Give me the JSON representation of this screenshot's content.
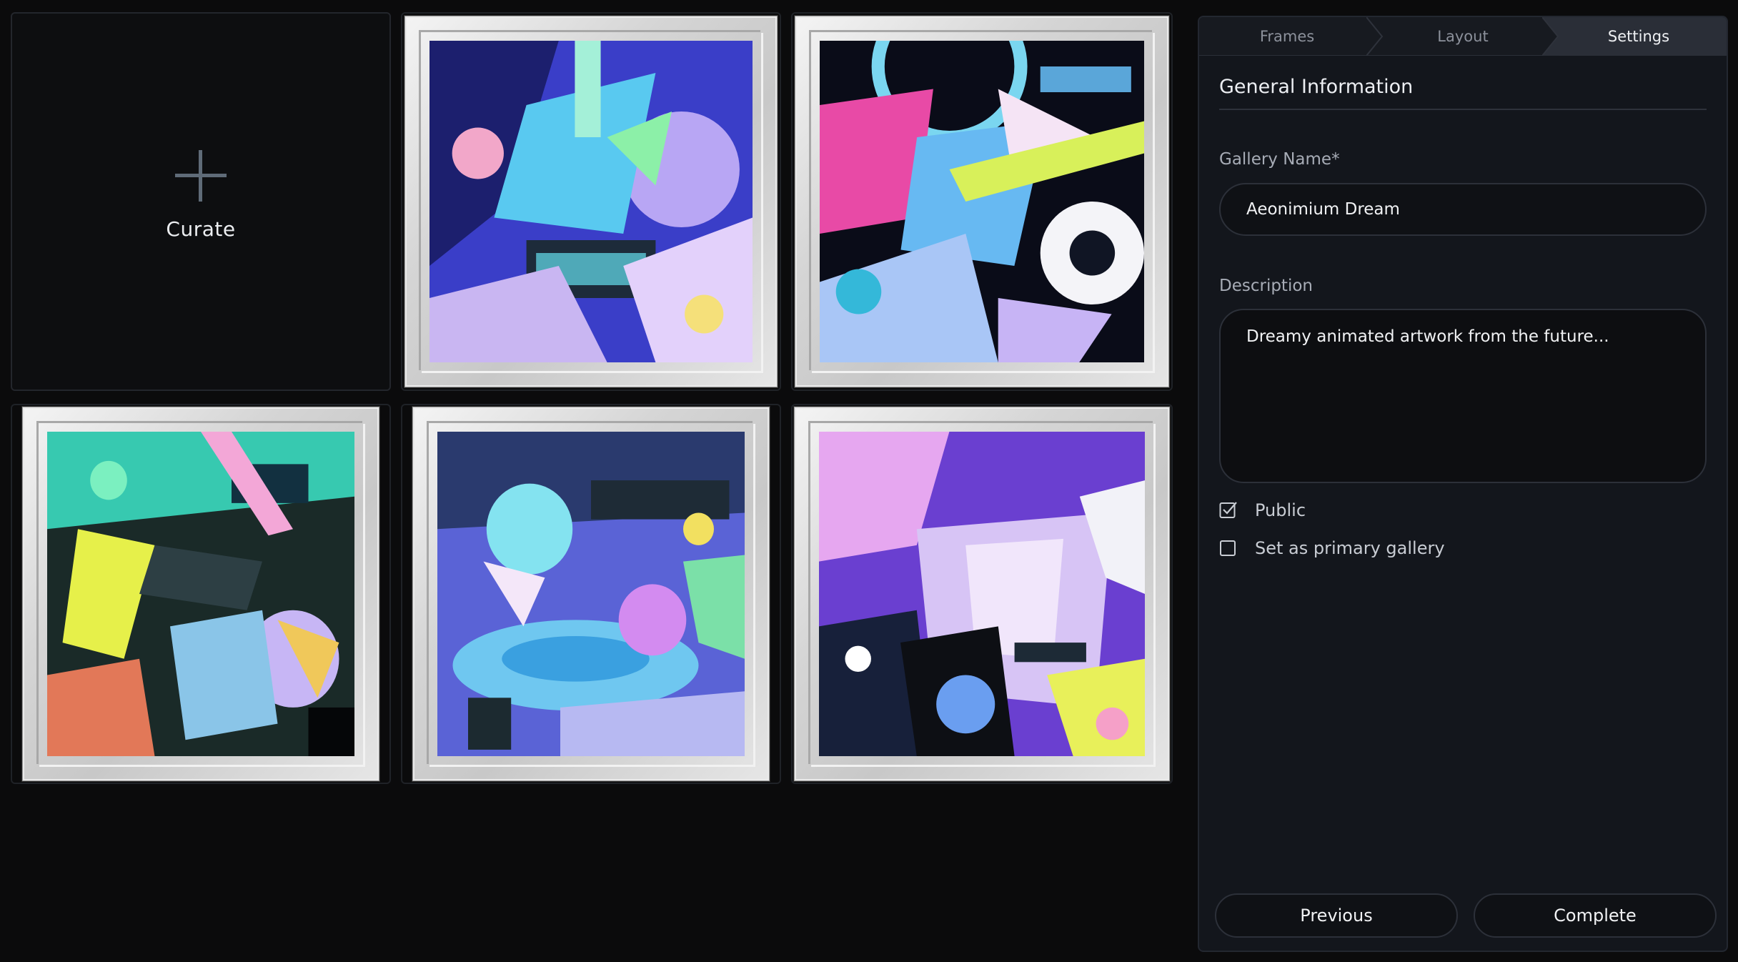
{
  "gallery": {
    "curate_label": "Curate",
    "icons": {
      "add": "plus-icon"
    },
    "artworks": [
      {
        "name": "artwork-1"
      },
      {
        "name": "artwork-2"
      },
      {
        "name": "artwork-3"
      },
      {
        "name": "artwork-4"
      },
      {
        "name": "artwork-5"
      }
    ]
  },
  "panel": {
    "steps": [
      {
        "label": "Frames",
        "active": false
      },
      {
        "label": "Layout",
        "active": false
      },
      {
        "label": "Settings",
        "active": true
      }
    ],
    "section_title": "General Information",
    "gallery_name": {
      "label": "Gallery Name*",
      "value": "Aeonimium Dream"
    },
    "description": {
      "label": "Description",
      "value": "Dreamy animated artwork from the future..."
    },
    "options": {
      "public": {
        "label": "Public",
        "checked": true
      },
      "primary": {
        "label": "Set as primary gallery",
        "checked": false
      }
    },
    "buttons": {
      "previous": "Previous",
      "complete": "Complete"
    }
  },
  "colors": {
    "background": "#0b0b0c",
    "panel": "#13161c",
    "active_step": "#2a2e37",
    "plus": "#5f6b78"
  }
}
